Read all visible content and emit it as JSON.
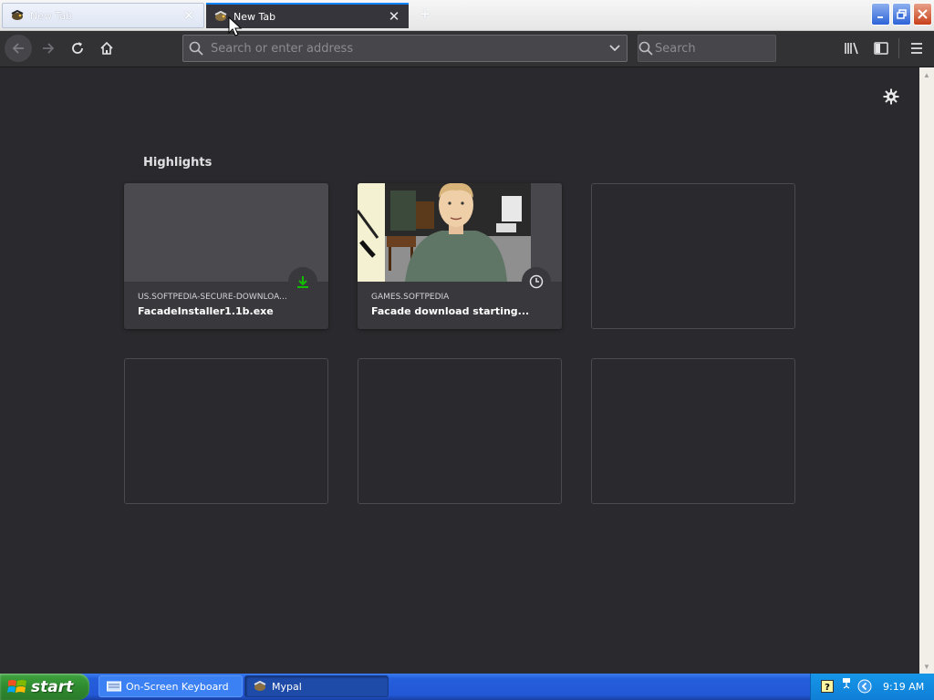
{
  "tabs": [
    {
      "title": "New Tab",
      "active": false
    },
    {
      "title": "New Tab",
      "active": true
    }
  ],
  "tab_close_glyph": "✕",
  "new_tab_glyph": "+",
  "window_controls": {
    "minimize": "minimize-icon",
    "maximize": "restore-icon",
    "close": "close-icon"
  },
  "urlbar": {
    "placeholder": "Search or enter address"
  },
  "searchbar": {
    "placeholder": "Search"
  },
  "highlights": {
    "title": "Highlights",
    "cards": [
      {
        "host": "US.SOFTPEDIA-SECURE-DOWNLOA...",
        "title": "FacadeInstaller1.1b.exe",
        "badge": "download-icon",
        "badge_color": "#12bc00"
      },
      {
        "host": "GAMES.SOFTPEDIA",
        "title": "Facade download starting...",
        "badge": "clock-icon"
      }
    ],
    "empty_slots": 4
  },
  "taskbar": {
    "start_label": "start",
    "items": [
      {
        "label": "On-Screen Keyboard",
        "icon": "keyboard-icon"
      },
      {
        "label": "Mypal",
        "icon": "mypal-icon"
      }
    ],
    "clock": "9:19 AM"
  },
  "colors": {
    "accent": "#0a84ff",
    "content_bg": "#2a2a2e",
    "download_green": "#12bc00"
  }
}
